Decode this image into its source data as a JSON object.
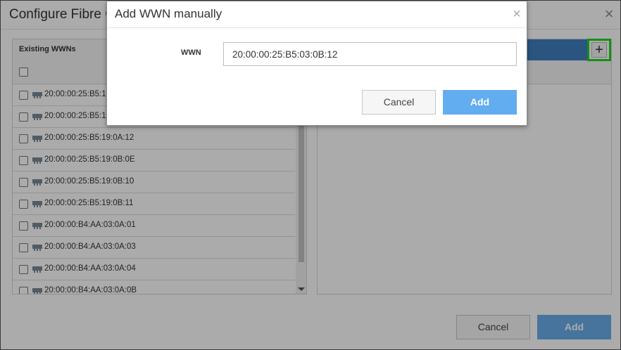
{
  "background_dialog": {
    "title": "Configure Fibre C",
    "close_symbol": "×",
    "existing_panel": {
      "label": "Existing WWNs",
      "items": [
        "20:00:00:25:B5:1",
        "20:00:00:25:B5:1",
        "20:00:00:25:B5:19:0A:12",
        "20:00:00:25:B5:19:0B:0E",
        "20:00:00:25:B5:19:0B:10",
        "20:00:00:25:B5:19:0B:11",
        "20:00:00:B4:AA:03:0A:01",
        "20:00:00:B4:AA:03:0A:03",
        "20:00:00:B4:AA:03:0A:04",
        "20:00:00:B4:AA:03:0A:0B"
      ]
    },
    "add_manual_symbol": "+",
    "footer": {
      "cancel_label": "Cancel",
      "add_label": "Add"
    }
  },
  "modal": {
    "title": "Add WWN manually",
    "close_symbol": "×",
    "wwn_label": "WWN",
    "wwn_value": "20:00:00:25:B5:03:0B:12",
    "cancel_label": "Cancel",
    "add_label": "Add"
  },
  "colors": {
    "primary_blue": "#62acf0",
    "header_blue": "#3f7fc1",
    "highlight_green": "#1ed71e"
  },
  "icons": {
    "row_icon": "port-icon",
    "close": "close-icon",
    "add": "plus-icon"
  }
}
